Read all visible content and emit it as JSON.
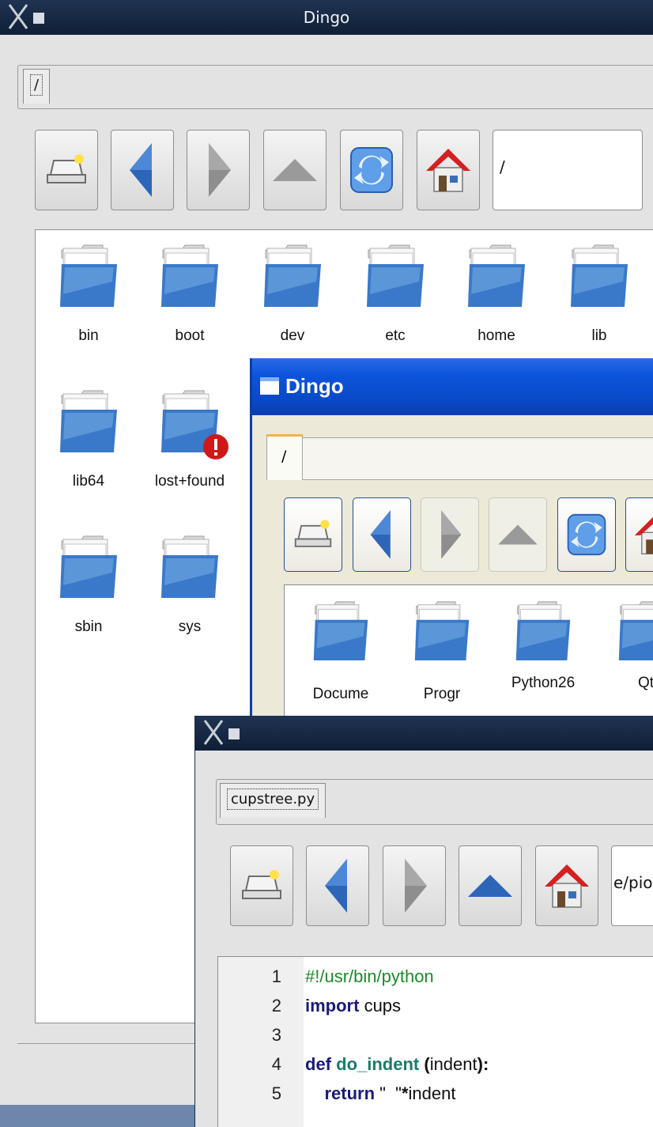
{
  "window_main": {
    "title": "Dingo",
    "tab_label": "/",
    "path_value": "/",
    "files": [
      {
        "name": "bin",
        "badge": false
      },
      {
        "name": "boot",
        "badge": false
      },
      {
        "name": "dev",
        "badge": false
      },
      {
        "name": "etc",
        "badge": false
      },
      {
        "name": "home",
        "badge": false
      },
      {
        "name": "lib",
        "badge": false
      },
      {
        "name": "lib64",
        "badge": false
      },
      {
        "name": "lost+found",
        "badge": true
      },
      {
        "name": "sbin",
        "badge": false
      },
      {
        "name": "sys",
        "badge": false
      }
    ]
  },
  "window_xp": {
    "title": "Dingo",
    "tab_label": "/",
    "files": [
      {
        "name": "Docume"
      },
      {
        "name": "Progr"
      },
      {
        "name": "Python26"
      },
      {
        "name": "Qt"
      }
    ]
  },
  "window_editor": {
    "tab_label": "cupstree.py",
    "path_value": "e/piot",
    "code_lines": [
      {
        "num": "1",
        "parts": [
          {
            "t": "#!/usr/bin/python",
            "c": "cm"
          }
        ]
      },
      {
        "num": "2",
        "parts": [
          {
            "t": "import",
            "c": "kw"
          },
          {
            "t": " cups",
            "c": ""
          }
        ]
      },
      {
        "num": "3",
        "parts": []
      },
      {
        "num": "4",
        "parts": [
          {
            "t": "def",
            "c": "kw"
          },
          {
            "t": " ",
            "c": ""
          },
          {
            "t": "do_indent",
            "c": "fn"
          },
          {
            "t": " ",
            "c": ""
          },
          {
            "t": "(",
            "c": "bd"
          },
          {
            "t": "indent",
            "c": ""
          },
          {
            "t": "):",
            "c": "bd"
          }
        ]
      },
      {
        "num": "5",
        "parts": [
          {
            "t": "    return",
            "c": "kw"
          },
          {
            "t": " \"  \"",
            "c": ""
          },
          {
            "t": "*",
            "c": "bd"
          },
          {
            "t": "indent",
            "c": ""
          }
        ]
      }
    ]
  },
  "icons": [
    "drive-icon",
    "back-arrow-icon",
    "forward-arrow-icon",
    "up-arrow-icon",
    "refresh-icon",
    "home-icon",
    "folder-icon",
    "error-badge-icon"
  ],
  "colors": {
    "folder_blue": "#3a78c9",
    "xp_title": "#0b54dc",
    "x_title": "#142640",
    "error_red": "#d01818"
  }
}
